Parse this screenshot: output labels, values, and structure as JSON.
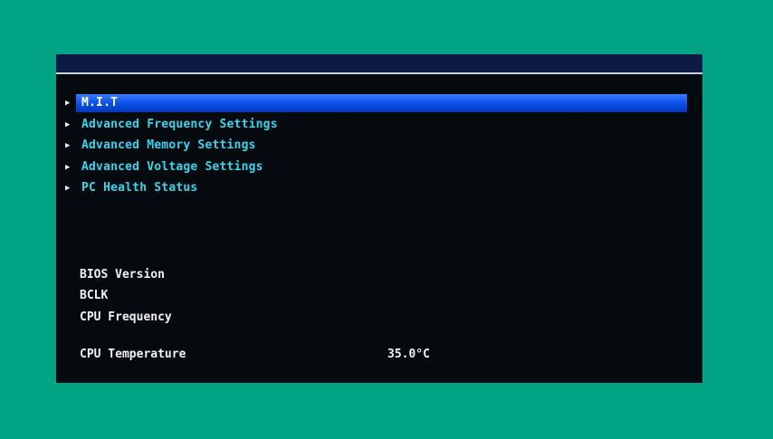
{
  "menu": {
    "items": [
      {
        "label": "M.I.T",
        "selected": true
      },
      {
        "label": "Advanced Frequency Settings",
        "selected": false
      },
      {
        "label": "Advanced Memory Settings",
        "selected": false
      },
      {
        "label": "Advanced Voltage Settings",
        "selected": false
      },
      {
        "label": "PC Health Status",
        "selected": false
      }
    ]
  },
  "info": {
    "bios_version": {
      "label": "BIOS Version",
      "value": ""
    },
    "bclk": {
      "label": "BCLK",
      "value": ""
    },
    "cpu_frequency": {
      "label": "CPU Frequency",
      "value": ""
    },
    "cpu_temperature": {
      "label": "CPU Temperature",
      "value": "35.0°C"
    }
  },
  "colors": {
    "background": "#00a383",
    "panel": "#050a0f",
    "header": "#0c1a44",
    "menu_text": "#35d6ee",
    "highlight": "#0a4ee6"
  }
}
